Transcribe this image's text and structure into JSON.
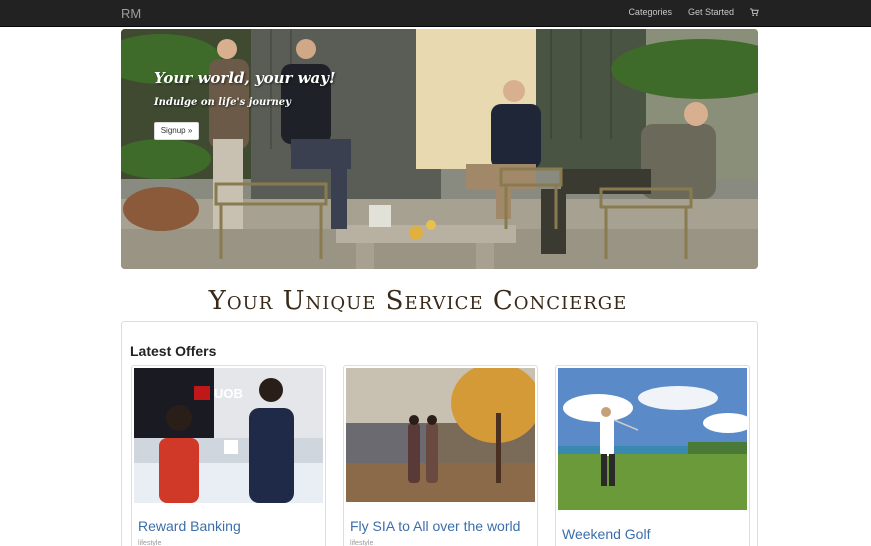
{
  "navbar": {
    "brand": "RM",
    "links": [
      "Categories",
      "Get Started"
    ],
    "cart_icon": "shopping-cart-icon"
  },
  "hero": {
    "title": "Your world, your way!",
    "subtitle": "Indulge on life's journey",
    "button_label": "Signup »"
  },
  "page_title": "Your Unique Service Concierge",
  "offers": {
    "heading": "Latest Offers",
    "cards": [
      {
        "title": "Reward Banking",
        "tag": "lifestyle"
      },
      {
        "title": "Fly SIA to All over the world",
        "tag": "lifestyle"
      },
      {
        "title": "Weekend Golf",
        "tag": ""
      }
    ]
  },
  "colors": {
    "navbar_bg": "#222222",
    "link_blue": "#3b6eaa",
    "heading_brown": "#3a2a1a"
  }
}
